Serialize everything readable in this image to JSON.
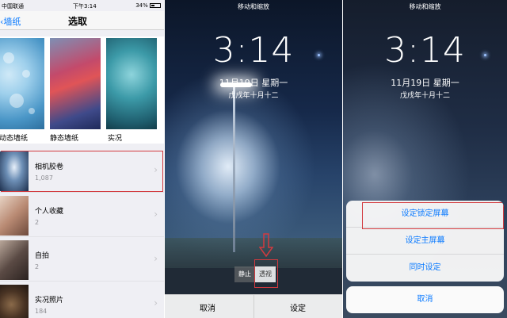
{
  "panel1": {
    "status": {
      "carrier": "中国联通",
      "time": "下午3:14",
      "battery": "34%"
    },
    "nav": {
      "back": "墙纸",
      "title": "选取"
    },
    "wallpapers": [
      {
        "label": "动态墙纸"
      },
      {
        "label": "静态墙纸"
      },
      {
        "label": "实况"
      }
    ],
    "albums": [
      {
        "name": "相机胶卷",
        "count": "1,087"
      },
      {
        "name": "个人收藏",
        "count": "2"
      },
      {
        "name": "自拍",
        "count": "2"
      },
      {
        "name": "实况照片",
        "count": "184"
      }
    ]
  },
  "panel2": {
    "top_note": "移动和缩放",
    "time": "3:14",
    "date": "11月19日 星期一",
    "lunar": "戊戌年十月十二",
    "segment": {
      "still": "静止",
      "perspective": "透视"
    },
    "bottom": {
      "cancel": "取消",
      "set": "设定"
    }
  },
  "panel3": {
    "top_note": "移动和缩放",
    "time": "3:14",
    "date": "11月19日 星期一",
    "lunar": "戊戌年十月十二",
    "options": [
      "设定锁定屏幕",
      "设定主屏幕",
      "同时设定"
    ],
    "cancel": "取消"
  },
  "colors": {
    "accent": "#0a7aff",
    "highlight_frame": "#d23a3f"
  }
}
